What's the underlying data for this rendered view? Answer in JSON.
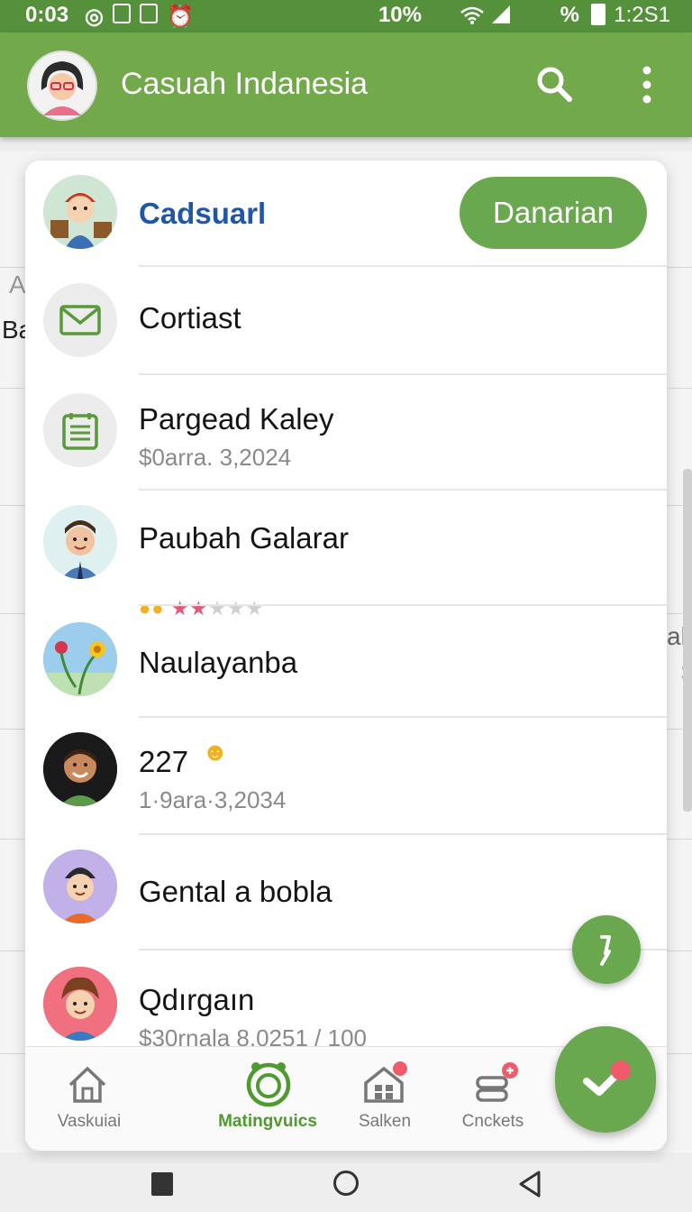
{
  "status_bar": {
    "time": "0:03",
    "battery_text": "10%",
    "extra_text": "%",
    "clock_right": "1:2S1"
  },
  "app_bar": {
    "title": "Casuah Indanesia",
    "avatar_icon": "user-avatar-icon",
    "search_icon": "search-icon",
    "more_icon": "more-vert-icon"
  },
  "background": {
    "left_hint_1": "A",
    "left_hint_2": "Ba",
    "right_hint_1": "al",
    "right_hint_2": "$"
  },
  "list": {
    "items": [
      {
        "primary": "Cadsuarl",
        "button": "Danarian",
        "avatar": "kid-avatar-icon"
      },
      {
        "primary": "Cortiast",
        "icon": "mail-icon"
      },
      {
        "primary": "Pargead Kaley",
        "secondary": "$0arra. 3,2024",
        "icon": "notes-icon"
      },
      {
        "primary": "Paubah Galarar",
        "rating": 2,
        "rating_max": 5,
        "avatar": "man-avatar-icon"
      },
      {
        "primary": "Naulayanba",
        "avatar": "flowers-avatar-icon"
      },
      {
        "primary": "227",
        "secondary": "1·9ara·3,2034",
        "avatar": "smiling-man-avatar-icon"
      },
      {
        "primary": "Gental a bobla",
        "avatar": "boy-hat-avatar-icon"
      },
      {
        "primary": "Qdırgaın",
        "secondary": "$30rnala 8,0251 / 100",
        "avatar": "boy-avatar-icon"
      }
    ]
  },
  "bottom_nav": {
    "items": [
      {
        "label": "Vaskuiai",
        "icon": "home-icon"
      },
      {
        "label": "Matingvuics",
        "icon": "smile-icon",
        "active": true
      },
      {
        "label": "Salken",
        "icon": "house-grid-icon"
      },
      {
        "label": "Cnckets",
        "icon": "stack-icon"
      }
    ]
  },
  "colors": {
    "primary_green": "#71a94b",
    "button_green": "#6aa84f",
    "link_blue": "#1f56a8",
    "star_pink": "#e05a78",
    "badge_red": "#ef5b6b"
  }
}
